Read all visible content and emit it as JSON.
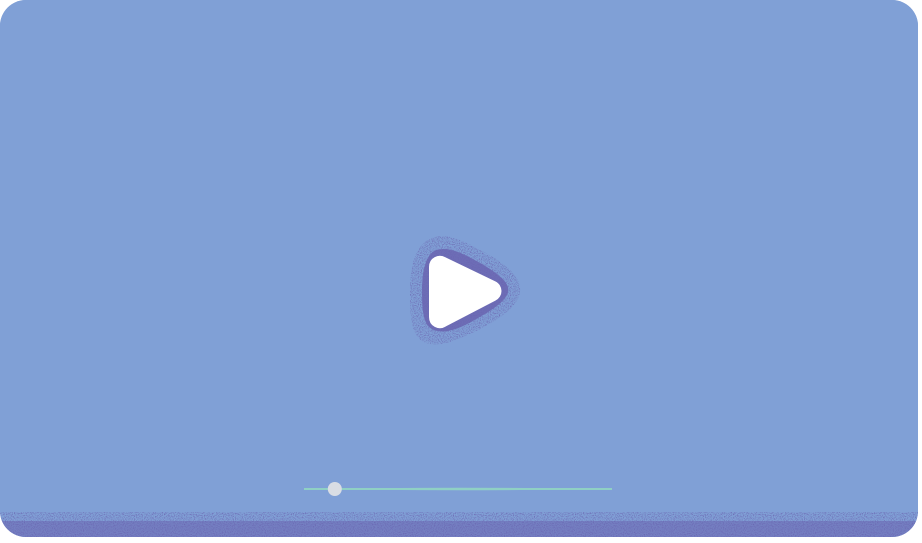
{
  "player": {
    "background_color": "#80a0d6",
    "grain_color": "#6a64b0",
    "play_icon": "play-icon",
    "play_icon_color": "#ffffff",
    "progress": {
      "fraction": 0.1,
      "track_color": "#8fd0c4",
      "thumb_color": "#d9dde4"
    }
  }
}
